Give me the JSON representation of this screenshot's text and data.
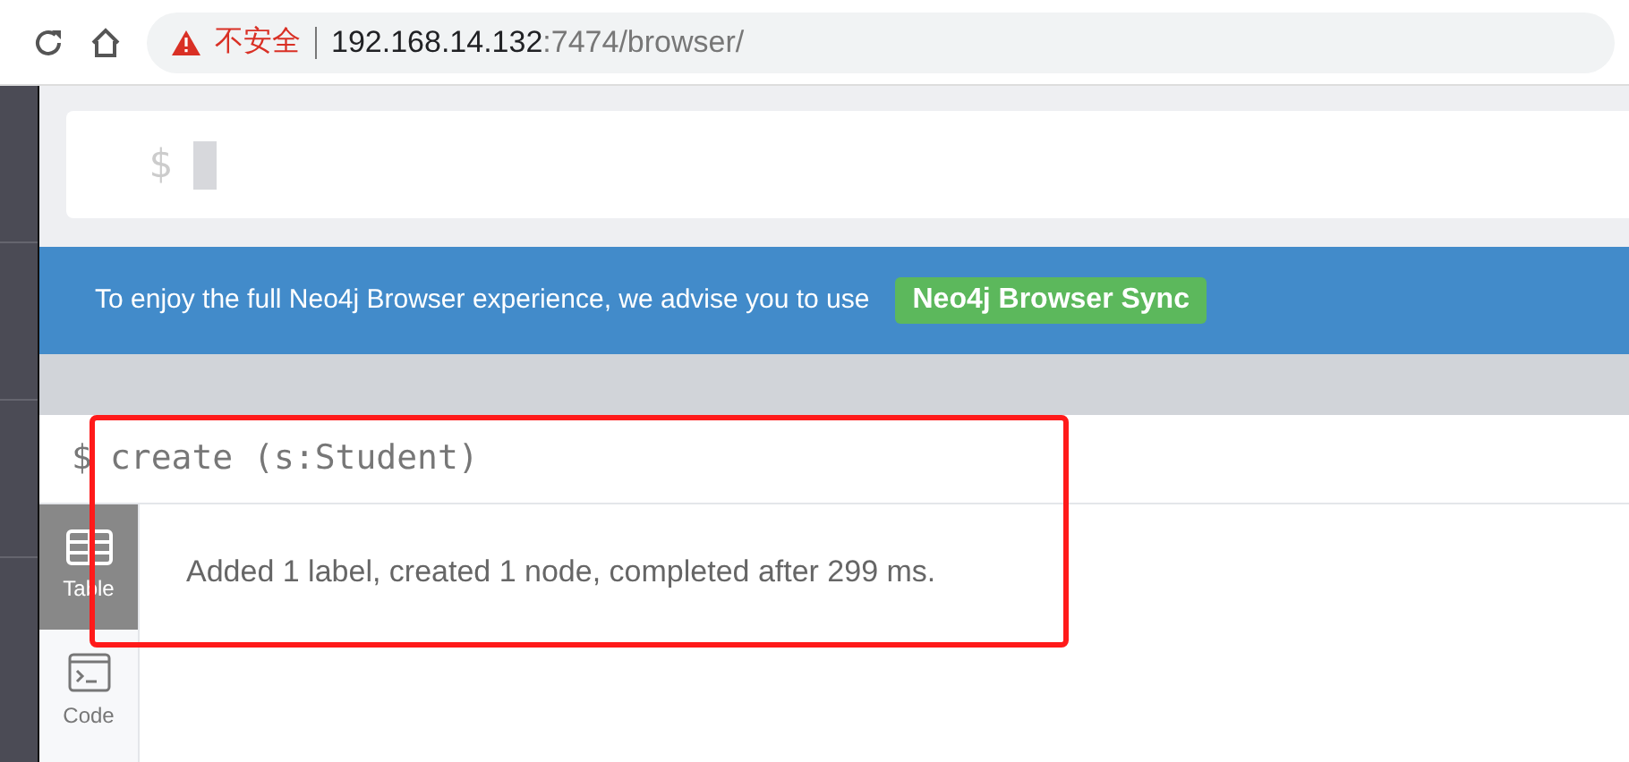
{
  "address_bar": {
    "security_label": "不安全",
    "host": "192.168.14.132",
    "path": ":7474/browser/"
  },
  "editor": {
    "prompt": "$"
  },
  "banner": {
    "text": "To enjoy the full Neo4j Browser experience, we advise you to use",
    "button": "Neo4j Browser Sync"
  },
  "result_frame": {
    "prompt": "$",
    "command": "create (s:Student)",
    "view_tabs": [
      {
        "label": "Table",
        "kind": "table",
        "selected": true
      },
      {
        "label": "Code",
        "kind": "code",
        "selected": false
      }
    ],
    "message": "Added 1 label, created 1 node, completed after 299 ms."
  }
}
